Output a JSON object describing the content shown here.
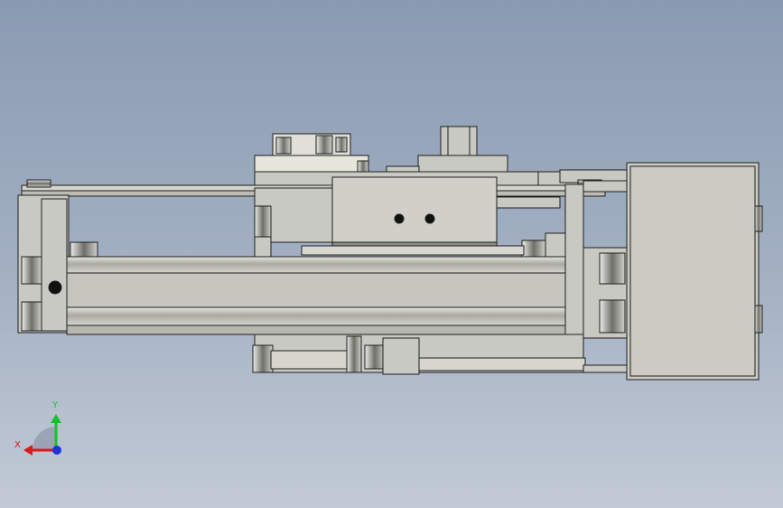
{
  "view": {
    "background_top": "#8a9ab2",
    "background_bottom": "#c2cad6"
  },
  "model": {
    "part_fill": "#c9c9c3",
    "part_fill_dark": "#b4b4ad",
    "edge_color": "#1e1e1e",
    "shadow_color": "#8c8c86"
  },
  "triad": {
    "x_label": "X",
    "y_label": "Y",
    "x_color": "#d81b1b",
    "y_color": "#16c22a",
    "z_color": "#1f35d6"
  }
}
